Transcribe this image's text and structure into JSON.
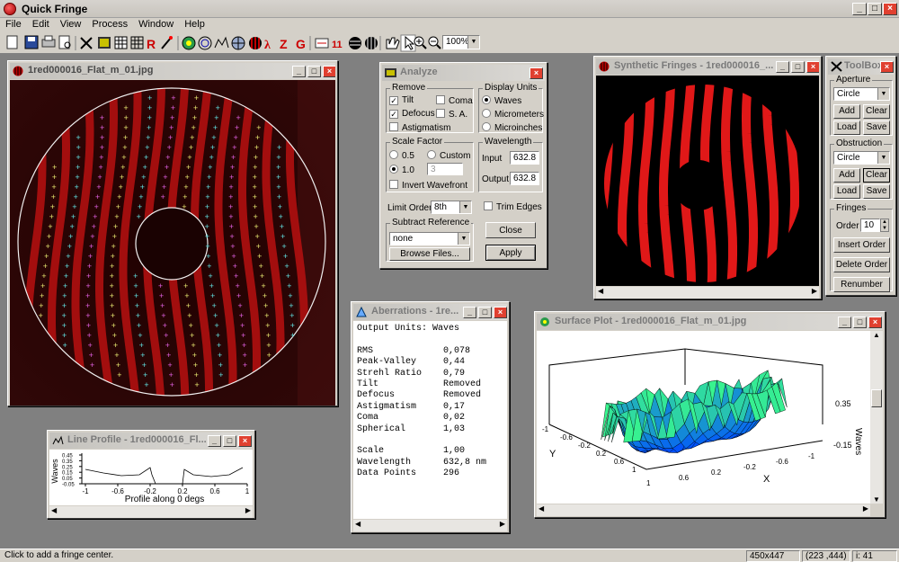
{
  "app": {
    "title": "Quick Fringe",
    "menu": [
      "File",
      "Edit",
      "View",
      "Process",
      "Window",
      "Help"
    ],
    "zoom": "100%"
  },
  "status": {
    "message": "Click to add a fringe center.",
    "size": "450x447",
    "coords": "(223 ,444)",
    "index": "i: 41"
  },
  "image_window": {
    "title": "1red000016_Flat_m_01.jpg"
  },
  "analyze": {
    "title": "Analyze",
    "remove_label": "Remove",
    "tilt": "Tilt",
    "coma": "Coma",
    "defocus": "Defocus",
    "sa": "S. A.",
    "astig": "Astigmatism",
    "units_label": "Display Units",
    "waves": "Waves",
    "micrometers": "Micrometers",
    "microinches": "Microinches",
    "scale_label": "Scale Factor",
    "s05": "0.5",
    "s10": "1.0",
    "custom": "Custom",
    "custom_value": "3",
    "invert": "Invert Wavefront",
    "wavelength_label": "Wavelength",
    "input_label": "Input",
    "input_value": "632.8",
    "output_label": "Output",
    "output_value": "632.8",
    "limit_label": "Limit Order",
    "limit_value": "8th",
    "trim": "Trim Edges",
    "subref_label": "Subtract Reference",
    "subref_value": "none",
    "browse": "Browse Files...",
    "close": "Close",
    "apply": "Apply"
  },
  "synthetic": {
    "title": "Synthetic Fringes - 1red000016_..."
  },
  "toolbox": {
    "title": "ToolBox",
    "aperture_label": "Aperture",
    "aperture_value": "Circle",
    "add": "Add",
    "clear": "Clear",
    "load": "Load",
    "save": "Save",
    "obstruction_label": "Obstruction",
    "obstruction_value": "Circle",
    "fringes_label": "Fringes",
    "order_label": "Order",
    "order_value": "10",
    "insert": "Insert Order",
    "delete": "Delete Order",
    "renumber": "Renumber"
  },
  "aberrations": {
    "title": "Aberrations - 1re...",
    "header": "Output Units: Waves",
    "rows": [
      {
        "name": "RMS",
        "value": "0,078"
      },
      {
        "name": "Peak-Valley",
        "value": "0,44"
      },
      {
        "name": "Strehl Ratio",
        "value": "0,79"
      },
      {
        "name": "Tilt",
        "value": "Removed"
      },
      {
        "name": "Defocus",
        "value": "Removed"
      },
      {
        "name": "Astigmatism",
        "value": "0,17"
      },
      {
        "name": "Coma",
        "value": "0,02"
      },
      {
        "name": "Spherical",
        "value": "1,03"
      }
    ],
    "rows2": [
      {
        "name": "Scale",
        "value": "1,00"
      },
      {
        "name": "Wavelength",
        "value": "632,8 nm"
      },
      {
        "name": "Data Points",
        "value": "296"
      }
    ]
  },
  "surface": {
    "title": "Surface Plot - 1red000016_Flat_m_01.jpg",
    "z_top": "0.35",
    "z_bottom": "-0.15",
    "z_label": "Waves",
    "x_label": "X",
    "y_label": "Y",
    "x_ticks": [
      "-1",
      "-0.6",
      "-0.2",
      "0.2",
      "0.6",
      "1"
    ],
    "y_ticks": [
      "-1",
      "-0.6",
      "-0.2",
      "0.2",
      "0.6",
      "1"
    ]
  },
  "profile": {
    "title": "Line Profile - 1red000016_Fl...",
    "ylabel": "Waves",
    "y_ticks": [
      "0.45",
      "0.35",
      "0.25",
      "0.15",
      "0.05",
      "-0.05"
    ],
    "x_ticks": [
      "-1",
      "-0.6",
      "-0.2",
      "0.2",
      "0.6",
      "1"
    ],
    "xlabel": "Profile along 0 degs"
  },
  "colors": {
    "fringe": "#e01818",
    "accent": "#0a246a"
  }
}
